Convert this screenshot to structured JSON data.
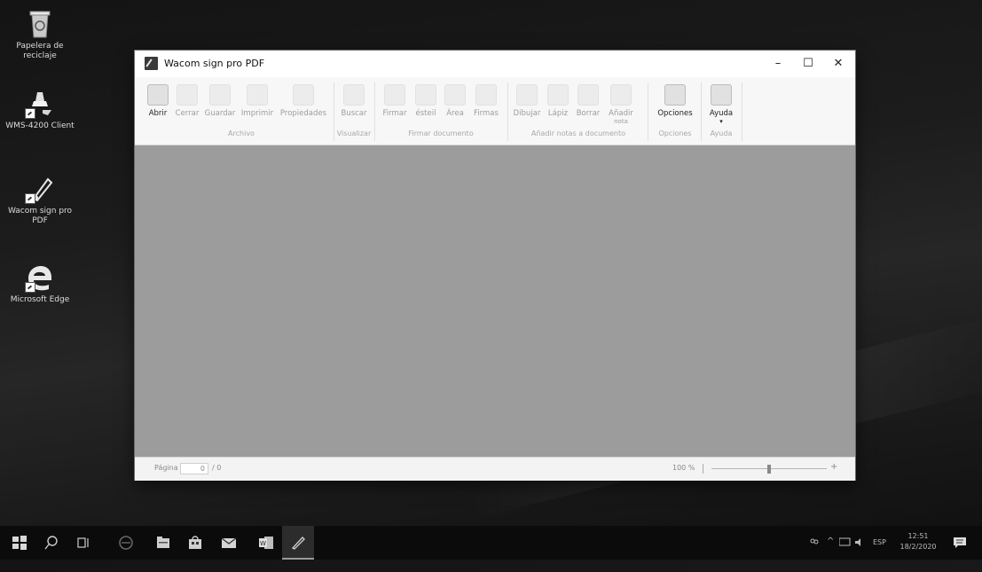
{
  "desktop": {
    "icons": [
      {
        "label": "Papelera de reciclaje",
        "icon": "recycle-bin-icon"
      },
      {
        "label": "WMS-4200 Client",
        "icon": "client-app-icon"
      },
      {
        "label": "Wacom sign pro PDF",
        "icon": "wacom-pen-icon"
      },
      {
        "label": "Microsoft Edge",
        "icon": "edge-icon"
      }
    ]
  },
  "window": {
    "title": "Wacom sign pro PDF",
    "controls": {
      "minimize": "–",
      "maximize": "☐",
      "close": "✕"
    }
  },
  "ribbon": {
    "buttons": [
      {
        "label": "Abrir",
        "icon": "folder-open-icon",
        "enabled": true
      },
      {
        "label": "Cerrar",
        "icon": "close-doc-icon",
        "enabled": false
      },
      {
        "label": "Guardar",
        "icon": "save-icon",
        "enabled": false
      },
      {
        "label": "Imprimir",
        "icon": "print-icon",
        "enabled": false
      },
      {
        "label": "Propiedades",
        "icon": "properties-icon",
        "enabled": false
      },
      {
        "label": "Buscar",
        "icon": "search-icon",
        "enabled": false
      },
      {
        "label": "Firmar",
        "icon": "sign-icon",
        "enabled": false
      },
      {
        "label": "ésteil",
        "icon": "signature-field-icon",
        "enabled": false
      },
      {
        "label": "Área",
        "icon": "area-icon",
        "enabled": false
      },
      {
        "label": "Firmas",
        "icon": "signatures-icon",
        "enabled": false
      },
      {
        "label": "Dibujar",
        "icon": "draw-icon",
        "enabled": false
      },
      {
        "label": "Lápiz",
        "icon": "pencil-icon",
        "enabled": false
      },
      {
        "label": "Borrar",
        "icon": "eraser-icon",
        "enabled": false
      },
      {
        "label": "Añadir",
        "sub": "nota",
        "icon": "note-icon",
        "enabled": false
      },
      {
        "label": "Opciones",
        "icon": "gear-icon",
        "enabled": true
      },
      {
        "label": "Ayuda",
        "sub": "▾",
        "icon": "help-icon",
        "enabled": true
      }
    ],
    "groups": [
      "Archivo",
      "Visualizar",
      "Firmar documento",
      "Añadir notas a documento",
      "Opciones",
      "Ayuda"
    ]
  },
  "status": {
    "page_label": "Página",
    "page_value": "0",
    "page_total": "/ 0",
    "zoom": "100 %",
    "zoom_level_percent": 100
  },
  "taskbar": {
    "items": [
      "start-icon",
      "search-icon",
      "task-view-icon",
      "edge-icon",
      "explorer-icon",
      "store-icon",
      "mail-icon",
      "word-icon",
      "wacom-pen-icon"
    ],
    "language": "ESP",
    "time": "12:51",
    "date": "18/2/2020"
  }
}
